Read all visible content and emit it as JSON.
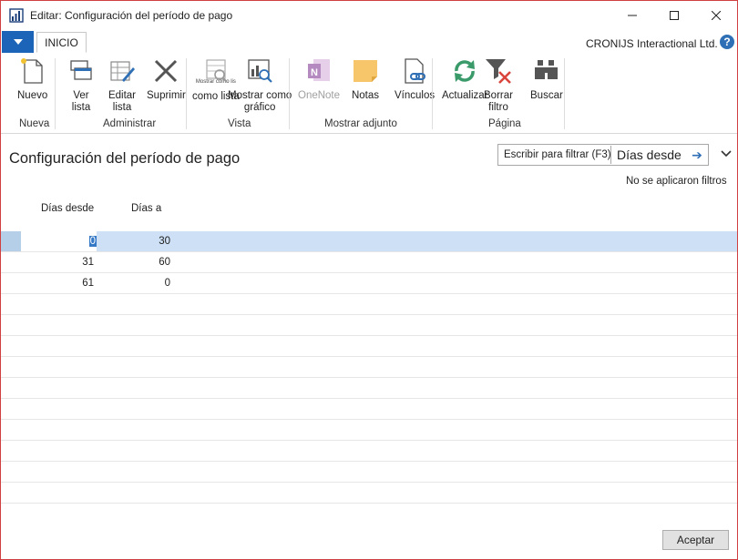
{
  "window": {
    "title": "Editar: Configuración del período de pago",
    "minimize": "—",
    "maximize": "☐",
    "close": "✕"
  },
  "ribbon": {
    "tab": "INICIO",
    "company": "CRONIJS Interactional Ltd.",
    "help": "?",
    "buttons": {
      "nuevo": "Nuevo",
      "ver_lista_1": "Ver",
      "ver_lista_2": "lista",
      "editar_lista_1": "Editar",
      "editar_lista_2": "lista",
      "suprimir": "Suprimir",
      "mostrar_lista_small": "Mostrar como lis",
      "mostrar_lista": "como lista",
      "mostrar_grafico_1": "Mostrar como",
      "mostrar_grafico_2": "gráfico",
      "onenote": "OneNote",
      "notas": "Notas",
      "vinculos": "Vínculos",
      "actualizar": "Actualizar",
      "borrar_filtro_1": "Borrar",
      "borrar_filtro_2": "filtro",
      "buscar": "Buscar"
    },
    "groups": {
      "nueva": "Nueva",
      "administrar": "Administrar",
      "vista": "Vista",
      "mostrar_adjunto": "Mostrar adjunto",
      "pagina": "Página"
    }
  },
  "page": {
    "title": "Configuración del período de pago",
    "filter_label": "Escribir para filtrar (F3)",
    "filter_field": "Días desde",
    "filter_status": "No se aplicaron filtros"
  },
  "grid": {
    "columns": [
      "Días desde",
      "Días a"
    ],
    "rows": [
      {
        "from": "0",
        "to": "30"
      },
      {
        "from": "31",
        "to": "60"
      },
      {
        "from": "61",
        "to": "0"
      }
    ]
  },
  "footer": {
    "accept": "Aceptar"
  },
  "colors": {
    "accent": "#1b64b8",
    "selection": "#cde0f5",
    "window_border": "#d04040"
  }
}
